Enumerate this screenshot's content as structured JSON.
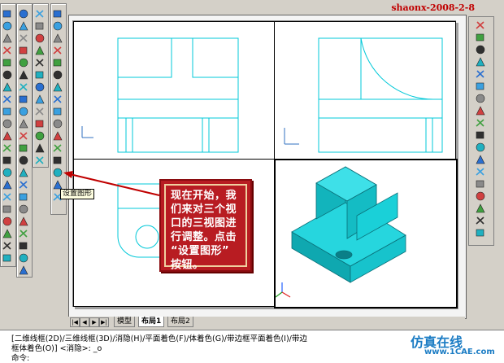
{
  "watermark": {
    "author_date": "shaonx-2008-2-8"
  },
  "tooltip": {
    "label": "设置图形"
  },
  "callout": {
    "lines": [
      "现在开始，我",
      "们来对三个视",
      "口的三视图进",
      "行调整。点击",
      "“设置图形”",
      "按钮。"
    ]
  },
  "tabs": {
    "nav": [
      "|◀",
      "◀",
      "▶",
      "▶|"
    ],
    "items": [
      {
        "label": "模型",
        "active": false
      },
      {
        "label": "布局1",
        "active": true
      },
      {
        "label": "布局2",
        "active": false
      }
    ]
  },
  "command": {
    "line1": "[二维线框(2D)/三维线框(3D)/消隐(H)/平面着色(F)/体着色(G)/带边框平面着色(I)/带边",
    "line2": "框体着色(O)] <消隐>: _o",
    "line3": "命令:"
  },
  "logo": {
    "text": "仿真在线",
    "sub": "www.1CAE.com"
  },
  "colors": {
    "drawing": "#00c8d8",
    "solid": "#19d0d8",
    "callout": "#b81c22",
    "accent_red": "#c00000"
  },
  "left_toolbar_icons": [
    "line-icon",
    "box-3d-icon",
    "sphere-icon",
    "cylinder-icon",
    "cone-icon",
    "wedge-icon",
    "torus-icon",
    "extrude-icon",
    "revolve-icon",
    "slice-icon",
    "section-icon",
    "interference-icon",
    "union-icon",
    "subtract-icon",
    "intersect-icon",
    "view-icon",
    "setup-drawing-icon",
    "setup-view-icon",
    "setup-profile-icon"
  ],
  "right_toolbar_icons": [
    "erase-icon",
    "copy-icon",
    "mirror-icon",
    "offset-icon",
    "array-icon",
    "move-icon",
    "rotate-icon",
    "scale-icon",
    "stretch-icon",
    "trim-icon",
    "extend-icon",
    "break-icon",
    "chamfer-icon",
    "fillet-icon",
    "explode-icon"
  ]
}
